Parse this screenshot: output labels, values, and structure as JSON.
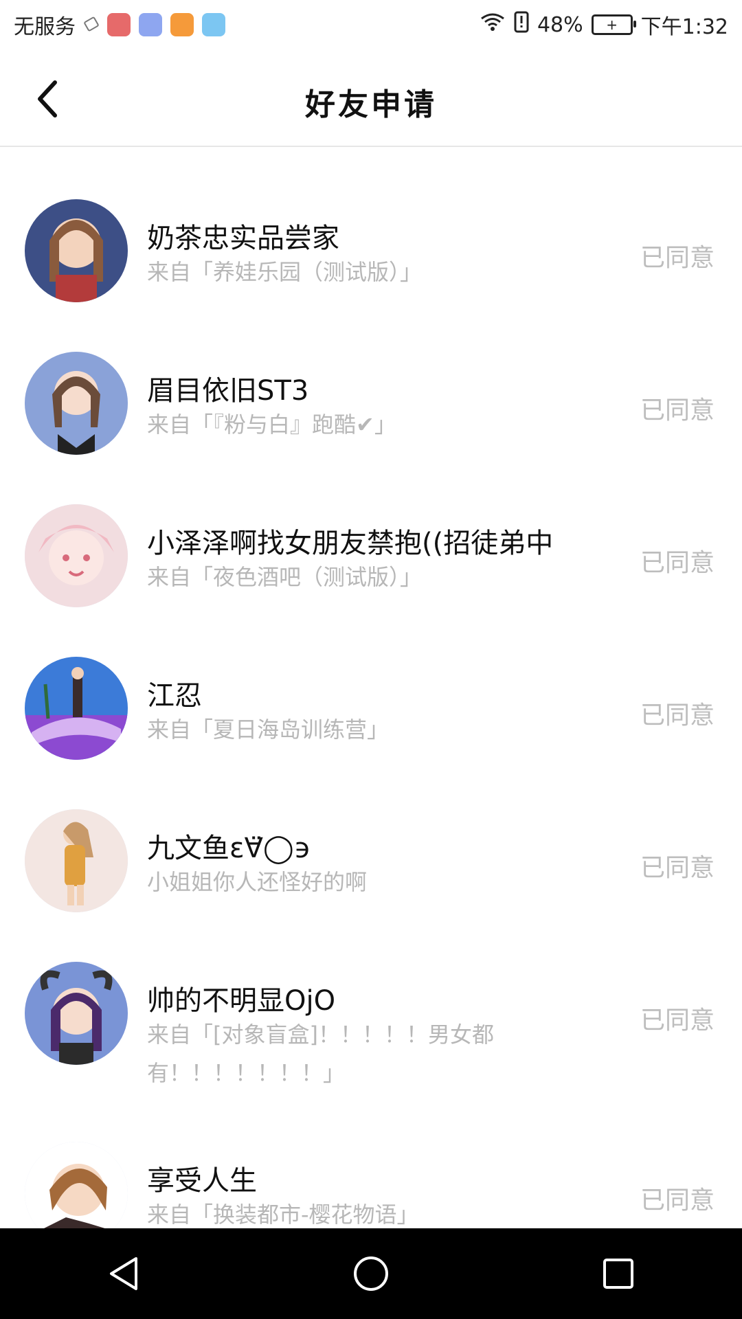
{
  "statusbar": {
    "carrier": "无服务",
    "battery_percent": "48%",
    "time": "下午1:32",
    "icons": [
      "sim-icon",
      "app-icon-red",
      "music-app-icon",
      "video-app-icon",
      "browser-app-icon",
      "wifi-icon",
      "alert-icon",
      "battery-icon"
    ]
  },
  "header": {
    "title": "好友申请",
    "back_icon": "back-arrow-icon"
  },
  "requests": [
    {
      "name": "奶茶忠实品尝家",
      "source": "来自「养娃乐园（测试版）」",
      "status": "已同意",
      "avatar_color": "#3d4f86"
    },
    {
      "name": "眉目依旧ST3",
      "source": "来自「『粉与白』跑酷✔」",
      "status": "已同意",
      "avatar_color": "#8aa2d8"
    },
    {
      "name": "小泽泽啊找女朋友禁抱((招徒弟中",
      "source": "来自「夜色酒吧（测试版）」",
      "status": "已同意",
      "avatar_color": "#f2dde0"
    },
    {
      "name": "江忍",
      "source": "来自「夏日海岛训练营」",
      "status": "已同意",
      "avatar_color": "#6a3bb0"
    },
    {
      "name": "九文鱼ε∀̈◯϶",
      "source": "小姐姐你人还怪好的啊",
      "status": "已同意",
      "avatar_color": "#f3e6e2"
    },
    {
      "name": "帅的不明显OjO",
      "source": "来自「[对象盲盒]！！！！！男女都有！！！！！！！」",
      "status": "已同意",
      "avatar_color": "#7a94d6"
    },
    {
      "name": "享受人生",
      "source": "来自「换装都市-樱花物语」",
      "status": "已同意",
      "avatar_color": "#a46a3a"
    }
  ],
  "navbar": {
    "back": "nav-back-icon",
    "home": "nav-home-icon",
    "recents": "nav-recents-icon"
  }
}
